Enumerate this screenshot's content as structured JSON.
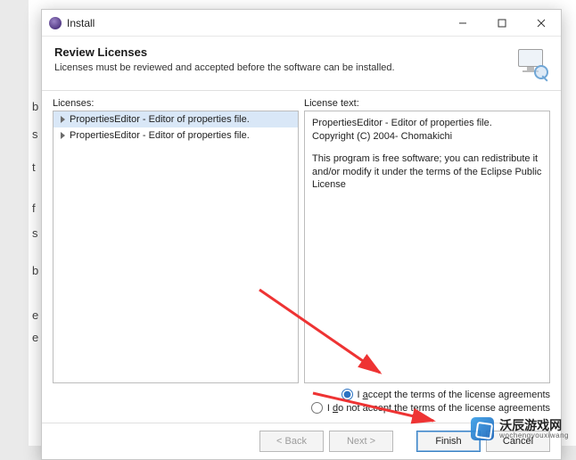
{
  "window": {
    "title": "Install",
    "heading": "Review Licenses",
    "subheading": "Licenses must be reviewed and accepted before the software can be installed."
  },
  "panes": {
    "licenses_label": "Licenses:",
    "license_text_label": "License text:"
  },
  "tree": {
    "items": [
      "PropertiesEditor - Editor of properties file.",
      "PropertiesEditor - Editor of properties file."
    ]
  },
  "license": {
    "line1": "PropertiesEditor - Editor of properties file.",
    "line2": "Copyright (C) 2004-  Chomakichi",
    "para": "This program is free software; you can redistribute it and/or modify it under the terms of the Eclipse Public License"
  },
  "radios": {
    "accept_pre": "I ",
    "accept_mn": "a",
    "accept_post": "ccept the terms of the license agreements",
    "decline_pre": "I ",
    "decline_mn": "d",
    "decline_post": "o not accept the terms of the license agreements"
  },
  "buttons": {
    "back": "< Back",
    "next": "Next >",
    "finish": "Finish",
    "cancel": "Cancel"
  },
  "watermark": {
    "brand": "沃辰游戏网",
    "sub": "wochengyouxiwang"
  }
}
